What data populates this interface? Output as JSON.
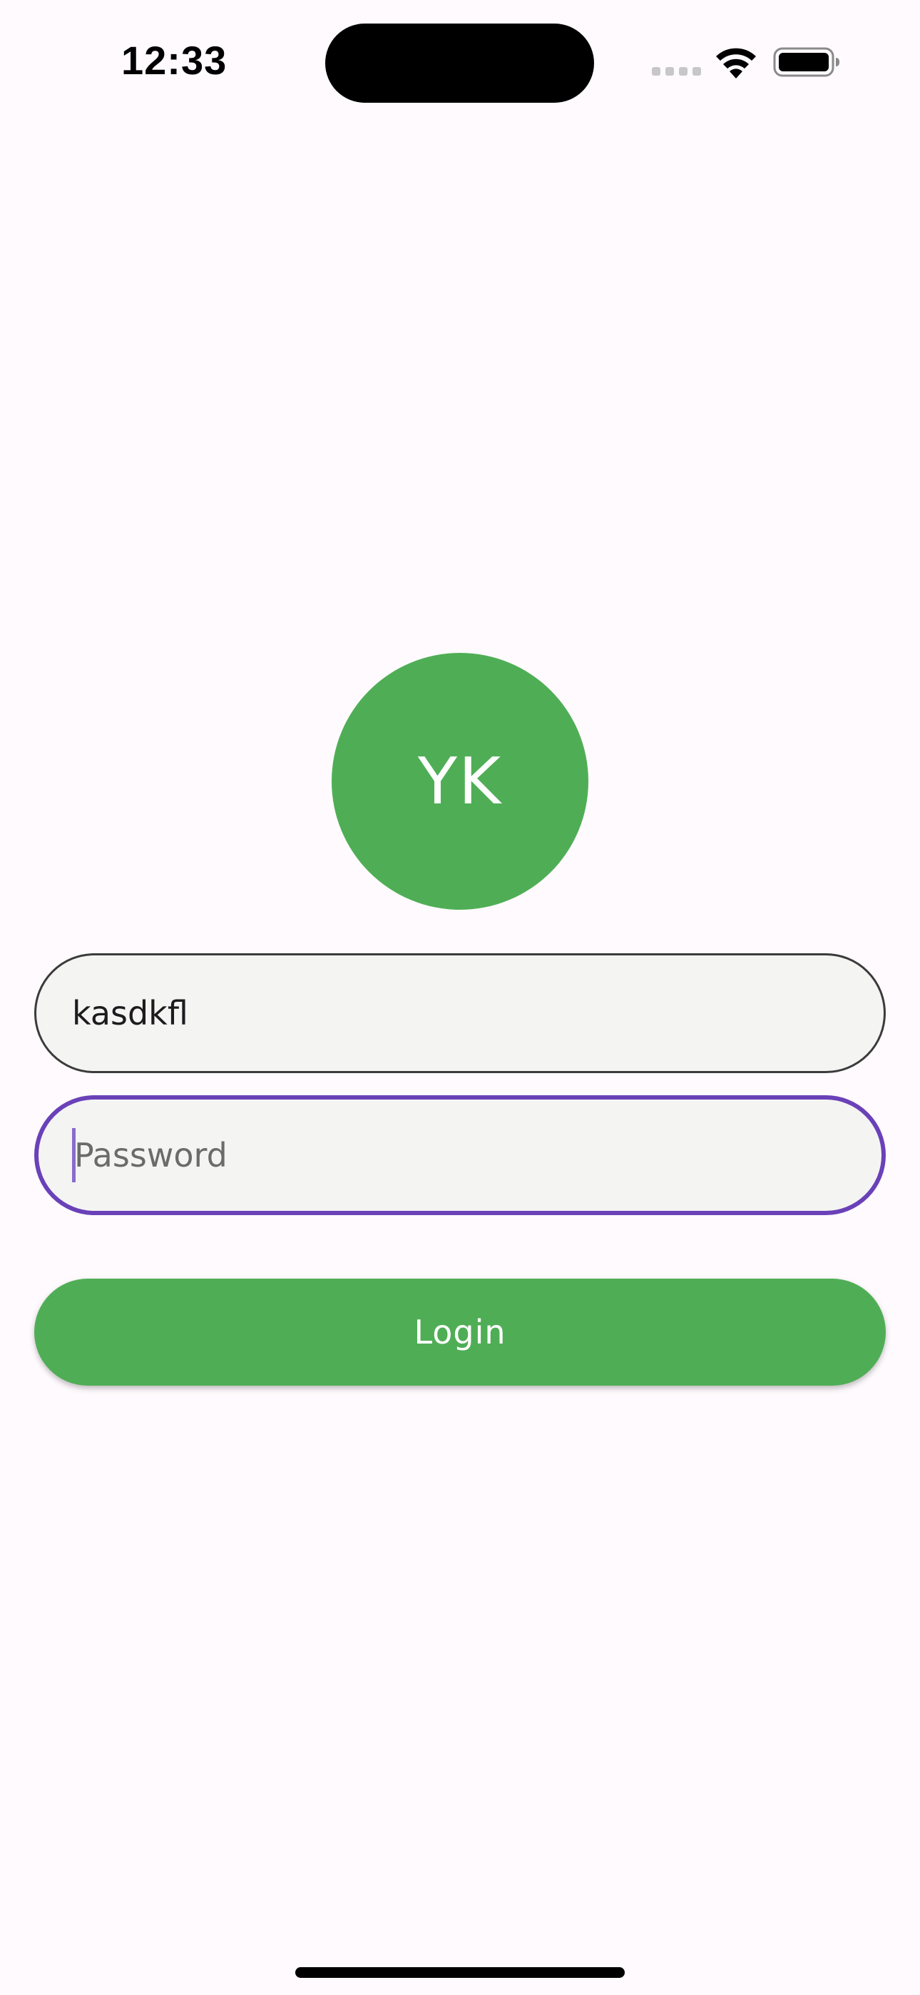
{
  "status_bar": {
    "time": "12:33"
  },
  "avatar": {
    "initials": "YK",
    "color": "#4fae55"
  },
  "login_form": {
    "username_value": "kasdkfl",
    "password_placeholder": "Password",
    "login_label": "Login"
  },
  "colors": {
    "accent": "#4fae55",
    "focus_border": "#6a41b8",
    "background": "#fefafd"
  },
  "icons": [
    "signal-icon",
    "wifi-icon",
    "battery-icon"
  ]
}
